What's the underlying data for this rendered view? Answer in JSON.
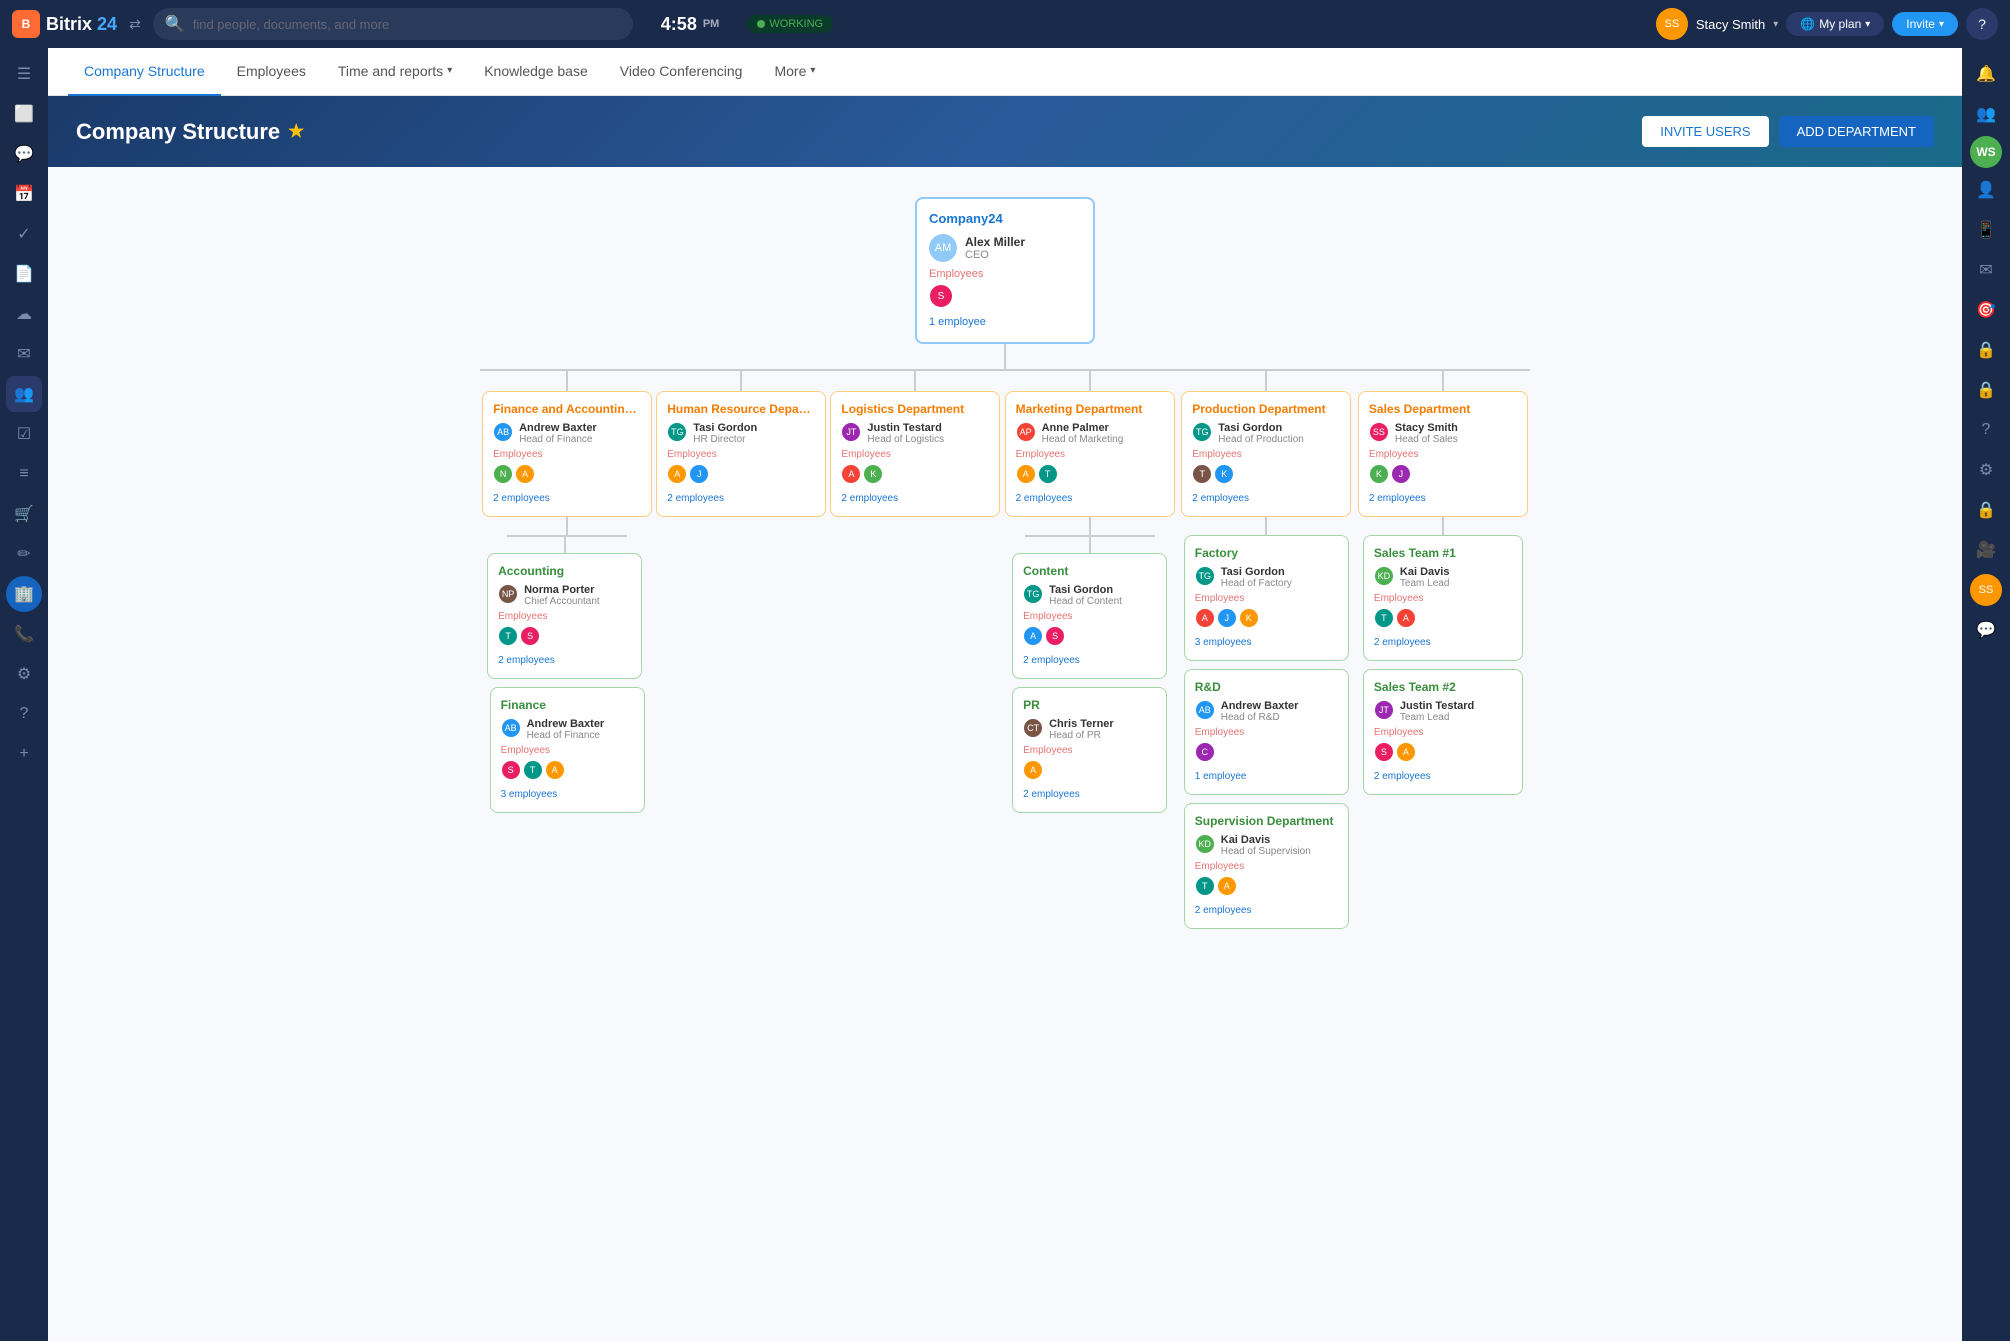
{
  "app": {
    "name": "Bitrix",
    "name2": "24",
    "search_placeholder": "find people, documents, and more",
    "time": "4:58",
    "time_suffix": "PM",
    "status": "WORKING",
    "user_name": "Stacy Smith",
    "plan_label": "My plan",
    "invite_label": "Invite"
  },
  "nav": {
    "tabs": [
      {
        "id": "company-structure",
        "label": "Company Structure",
        "active": true
      },
      {
        "id": "employees",
        "label": "Employees",
        "active": false
      },
      {
        "id": "time-reports",
        "label": "Time and reports",
        "active": false,
        "has_arrow": true
      },
      {
        "id": "knowledge-base",
        "label": "Knowledge base",
        "active": false
      },
      {
        "id": "video-conf",
        "label": "Video Conferencing",
        "active": false
      },
      {
        "id": "more",
        "label": "More",
        "active": false,
        "has_arrow": true
      }
    ]
  },
  "page": {
    "title": "Company Structure",
    "btn_invite": "INVITE USERS",
    "btn_add": "ADD DEPARTMENT"
  },
  "org": {
    "root": {
      "title": "Company24",
      "person_name": "Alex Miller",
      "person_role": "CEO",
      "employees_label": "Employees",
      "emp_count_label": "1 employee"
    },
    "departments": [
      {
        "id": "finance-accounting",
        "title": "Finance and Accounting De...",
        "person_name": "Andrew Baxter",
        "person_role": "Head of Finance",
        "employees_label": "Employees",
        "emp_count": "2 employees",
        "children": [
          {
            "id": "accounting",
            "title": "Accounting",
            "person_name": "Norma Porter",
            "person_role": "Chief Accountant",
            "employees_label": "Employees",
            "emp_count": "2 employees"
          },
          {
            "id": "finance",
            "title": "Finance",
            "person_name": "Andrew Baxter",
            "person_role": "Head of Finance",
            "employees_label": "Employees",
            "emp_count": "3 employees"
          }
        ]
      },
      {
        "id": "hr",
        "title": "Human Resource Departme...",
        "person_name": "Tasi Gordon",
        "person_role": "HR Director",
        "employees_label": "Employees",
        "emp_count": "2 employees",
        "children": []
      },
      {
        "id": "logistics",
        "title": "Logistics Department",
        "person_name": "Justin Testard",
        "person_role": "Head of Logistics",
        "employees_label": "Employees",
        "emp_count": "2 employees",
        "children": []
      },
      {
        "id": "marketing",
        "title": "Marketing Department",
        "person_name": "Anne Palmer",
        "person_role": "Head of Marketing",
        "employees_label": "Employees",
        "emp_count": "2 employees",
        "children": [
          {
            "id": "content",
            "title": "Content",
            "person_name": "Tasi Gordon",
            "person_role": "Head of Content",
            "employees_label": "Employees",
            "emp_count": "2 employees"
          },
          {
            "id": "pr",
            "title": "PR",
            "person_name": "Chris Terner",
            "person_role": "Head of PR",
            "employees_label": "Employees",
            "emp_count": "2 employees"
          }
        ]
      },
      {
        "id": "production",
        "title": "Production Department",
        "person_name": "Tasi Gordon",
        "person_role": "Head of Production",
        "employees_label": "Employees",
        "emp_count": "2 employees",
        "children": [
          {
            "id": "factory",
            "title": "Factory",
            "person_name": "Tasi Gordon",
            "person_role": "Head of Factory",
            "employees_label": "Employees",
            "emp_count": "3 employees"
          },
          {
            "id": "rd",
            "title": "R&D",
            "person_name": "Andrew Baxter",
            "person_role": "Head of R&D",
            "employees_label": "Employees",
            "emp_count": "1 employee"
          },
          {
            "id": "supervision",
            "title": "Supervision Department",
            "person_name": "Kai Davis",
            "person_role": "Head of Supervision",
            "employees_label": "Employees",
            "emp_count": "2 employees"
          }
        ]
      },
      {
        "id": "sales",
        "title": "Sales Department",
        "person_name": "Stacy Smith",
        "person_role": "Head of Sales",
        "employees_label": "Employees",
        "emp_count": "2 employees",
        "children": [
          {
            "id": "sales-team-1",
            "title": "Sales Team #1",
            "person_name": "Kai Davis",
            "person_role": "Team Lead",
            "employees_label": "Employees",
            "emp_count": "2 employees"
          },
          {
            "id": "sales-team-2",
            "title": "Sales Team #2",
            "person_name": "Justin Testard",
            "person_role": "Team Lead",
            "employees_label": "Employees",
            "emp_count": "2 employees"
          }
        ]
      }
    ]
  },
  "sidebar_icons": [
    "☰",
    "●",
    "◯",
    "□",
    "△",
    "▽",
    "◁",
    "▷",
    "⊕",
    "⊖",
    "⊗",
    "⊘"
  ],
  "right_sidebar_icons": [
    "🔔",
    "👥",
    "✉",
    "📋",
    "🔒",
    "❓",
    "⚙",
    "+"
  ]
}
